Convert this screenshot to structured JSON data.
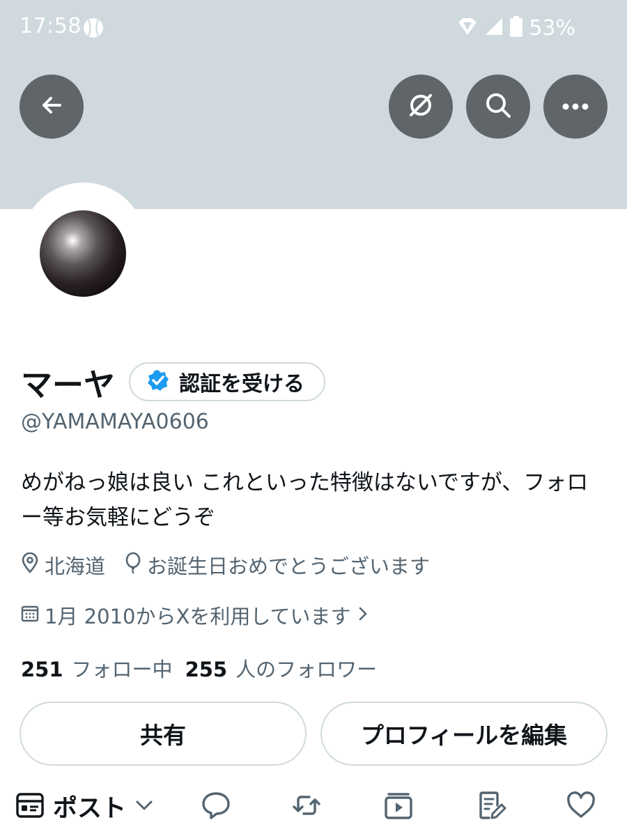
{
  "status_bar": {
    "time": "17:58",
    "battery": "53%"
  },
  "header": {
    "back_icon": "arrow-left-icon",
    "grok_icon": "grok-icon",
    "search_icon": "search-icon",
    "more_icon": "more-horizontal-icon"
  },
  "profile": {
    "display_name": "マーヤ",
    "verify_label": "認証を受ける",
    "handle": "@YAMAMAYA0606",
    "bio": "めがねっ娘は良い これといった特徴はないですが、フォロー等お気軽にどうぞ",
    "location": "北海道",
    "birthday": "お誕生日おめでとうございます",
    "joined": "1月 2010からXを利用しています",
    "following_count": "251",
    "following_label": "フォロー中",
    "followers_count": "255",
    "followers_label": "人のフォロワー"
  },
  "actions": {
    "share": "共有",
    "edit_profile": "プロフィールを編集"
  },
  "composer": {
    "type_label": "ポスト",
    "tools": [
      "comment-icon",
      "repost-icon",
      "video-icon",
      "edit-note-icon",
      "heart-icon"
    ]
  },
  "colors": {
    "banner": "#cfd9de",
    "verified_blue": "#1d9bf0",
    "secondary_text": "#536471",
    "header_button": "#5f6568"
  }
}
